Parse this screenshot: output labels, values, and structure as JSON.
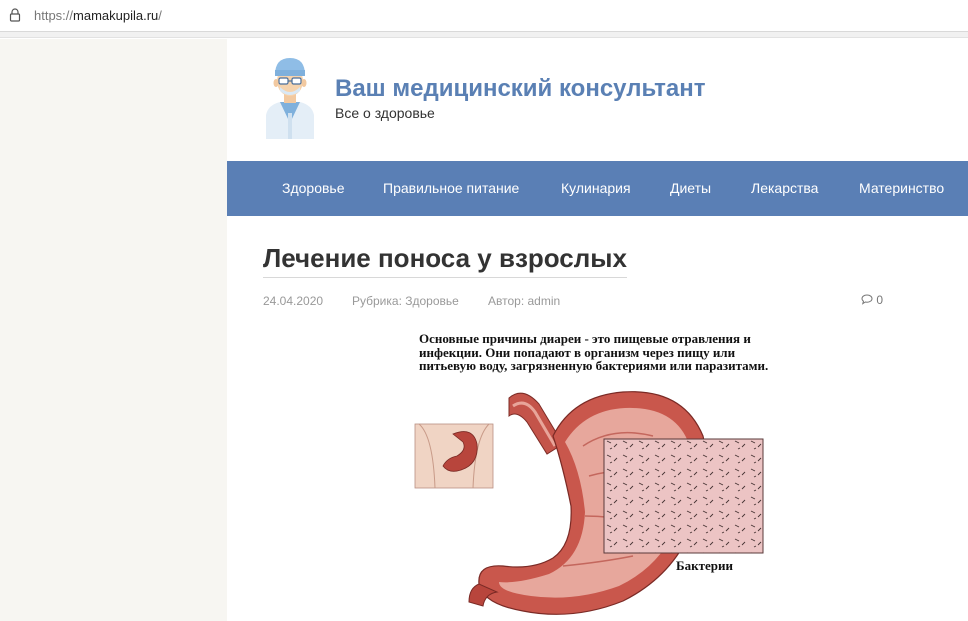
{
  "browser": {
    "url_scheme": "https://",
    "url_host": "mamakupila.ru",
    "url_path": "/"
  },
  "site": {
    "title": "Ваш медицинский консультант",
    "description": "Все о здоровье"
  },
  "nav": {
    "items": [
      "Здоровье",
      "Правильное питание",
      "Кулинария",
      "Диеты",
      "Лекарства",
      "Материнство"
    ]
  },
  "post": {
    "title": "Лечение поноса у взрослых",
    "date": "24.04.2020",
    "category": "Рубрика: Здоровье",
    "author": "Автор: admin",
    "comments_count": "0"
  },
  "figure": {
    "caption": "Основные причины диареи - это пищевые отравления и инфекции. Они попадают в организм через  пищу или питьевую воду, загрязненную  бактериями или паразитами.",
    "label": "Бактерии"
  },
  "colors": {
    "brand": "#5a80b4",
    "nav_background": "#5a7fb5",
    "left_background": "#f7f6f2"
  },
  "icons": [
    "lock-icon",
    "doctor-logo-icon",
    "comment-icon"
  ]
}
